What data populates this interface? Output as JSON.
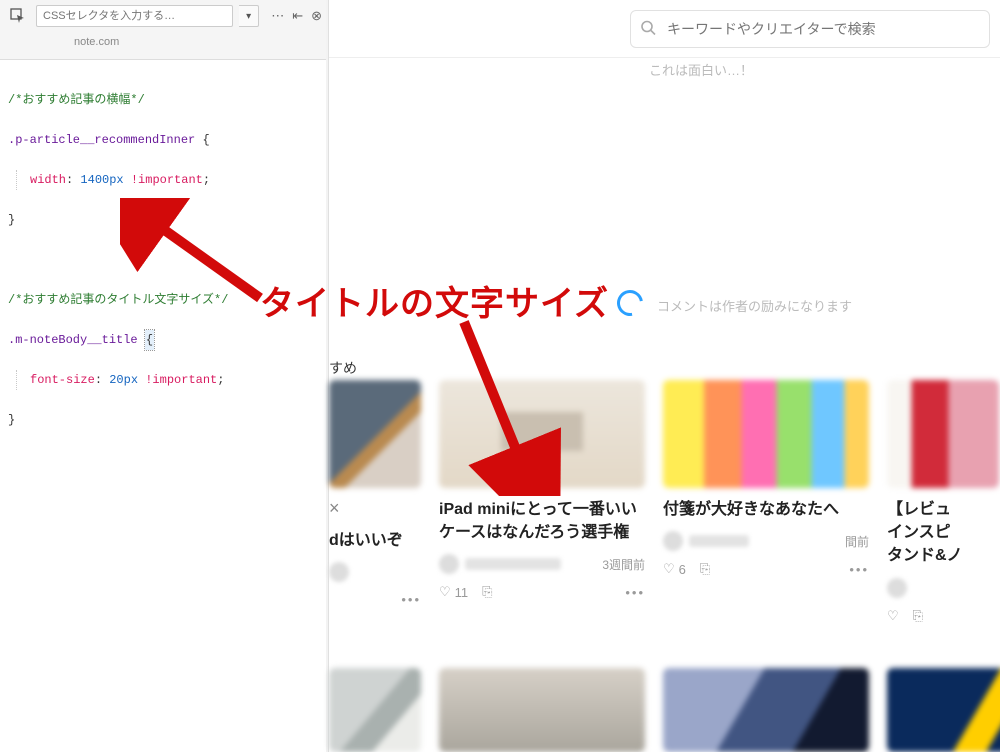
{
  "devtools": {
    "selector_placeholder": "CSSセレクタを入力する…",
    "url": "note.com",
    "dropdown_glyph": "▾",
    "menu_glyph": "⋯",
    "dock_toggle_glyph": "⇤",
    "close_glyph": "⊗"
  },
  "css": {
    "c1": "/*おすすめ記事の横幅*/",
    "s1": ".p-article__recommendInner",
    "p1": "width",
    "v1": "1400px",
    "imp": "!important",
    "c2": "/*おすすめ記事のタイトル文字サイズ*/",
    "s2": ".m-noteBody__title",
    "p2": "font-size",
    "v2": "20px",
    "brace_open": "{",
    "brace_close": "}",
    "semicolon": ";",
    "colon": ":"
  },
  "page": {
    "search_placeholder": "キーワードやクリエイターで検索",
    "faint_top": "これは面白い…！",
    "comment_hint": "コメントは作者の励みになります",
    "section_label": "すめ"
  },
  "annotation": {
    "text": "タイトルの文字サイズ"
  },
  "cards": [
    {
      "title_partial_suffix": "dはいいぞ",
      "close": "×",
      "kebab": "•••"
    },
    {
      "title": "iPad miniにとって一番いいケースはなんだろう選手権",
      "ago": "3週間前",
      "likes": "11",
      "kebab": "•••"
    },
    {
      "title": "付箋が大好きなあなたへ",
      "ago": "間前",
      "likes": "6",
      "kebab": "•••"
    },
    {
      "title_partial": "【レビュ\nインスピ\nタンド&ノ"
    }
  ],
  "icons": {
    "heart": "♡",
    "bookmark": "⎘"
  }
}
